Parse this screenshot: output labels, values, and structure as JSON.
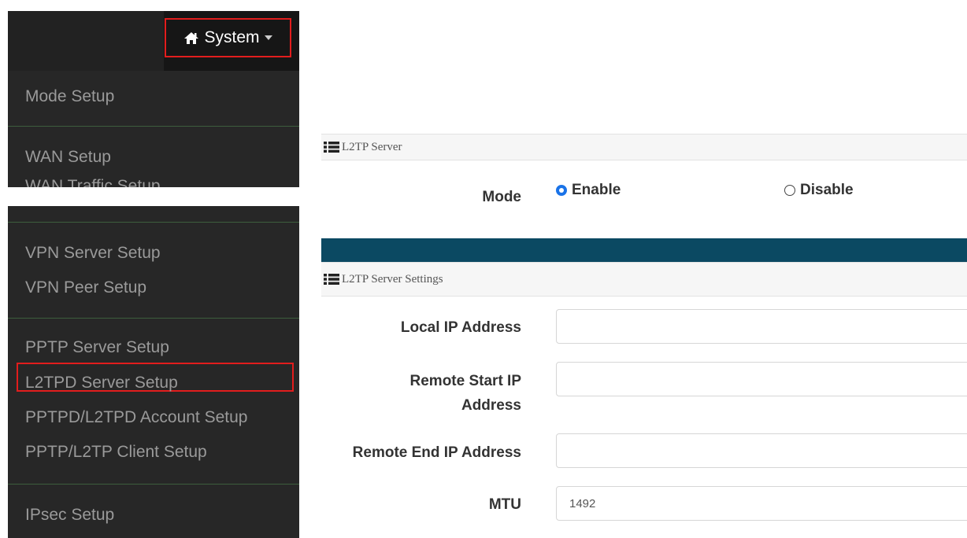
{
  "nav": {
    "system_label": "System",
    "menu_top": [
      "Mode Setup",
      "WAN Setup",
      "WAN Traffic Setup"
    ],
    "menu_bottom": [
      "VPN Server Setup",
      "VPN Peer Setup",
      "PPTP Server Setup",
      "L2TPD Server Setup",
      "PPTPD/L2TPD Account Setup",
      "PPTP/L2TP Client Setup",
      "IPsec Setup"
    ],
    "selected_item": "L2TPD Server Setup"
  },
  "l2tp_server": {
    "header": "L2TP Server",
    "mode_label": "Mode",
    "enable_label": "Enable",
    "disable_label": "Disable",
    "mode_selected": "Enable"
  },
  "l2tp_settings": {
    "header": "L2TP Server Settings",
    "local_ip_label": "Local IP Address",
    "local_ip_value": "",
    "remote_start_label_line1": "Remote Start IP",
    "remote_start_label_line2": "Address",
    "remote_start_value": "",
    "remote_end_label": "Remote End IP Address",
    "remote_end_value": "",
    "mtu_label": "MTU",
    "mtu_value": "1492"
  },
  "colors": {
    "highlight_border": "#e21d1d",
    "menu_bg": "#272727",
    "teal_bar": "#0b4962",
    "radio_selected": "#1a73e8"
  }
}
